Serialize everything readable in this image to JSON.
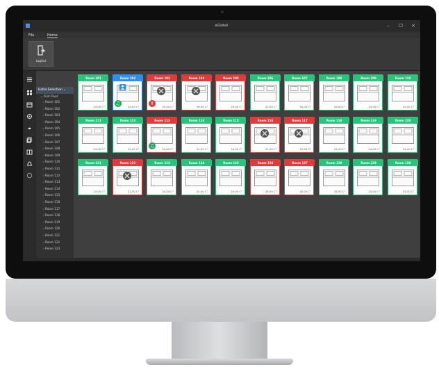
{
  "app": {
    "title": "eGlobal"
  },
  "window_controls": [
    "–",
    "☐",
    "×"
  ],
  "menu": {
    "file": "File",
    "home": "Home"
  },
  "ribbon": {
    "logout_label": "LogOut"
  },
  "tree": {
    "header": "Hotel Selection",
    "floor": "First Floor",
    "rooms": [
      "Room 101",
      "Room 102",
      "Room 103",
      "Room 104",
      "Room 105",
      "Room 106",
      "Room 107",
      "Room 108",
      "Room 109",
      "Room 110",
      "Room 111",
      "Room 112",
      "Room 113",
      "Room 114",
      "Room 115",
      "Room 116",
      "Room 117",
      "Room 118",
      "Room 119",
      "Room 120",
      "Room 121",
      "Room 122",
      "Room 123"
    ]
  },
  "colors": {
    "available": "#27c47a",
    "occupied": "#e03a3a",
    "selected": "#2d8ff0"
  },
  "rooms": [
    {
      "name": "Room 101",
      "status": "available",
      "temp": "24,00 C°"
    },
    {
      "name": "Room 102",
      "status": "selected",
      "temp": "22,00 C°",
      "badge": "green",
      "person": true
    },
    {
      "name": "Room 103",
      "status": "occupied",
      "temp": "20,00 C°",
      "badge": "red",
      "guest": true
    },
    {
      "name": "Room 104",
      "status": "occupied",
      "temp": "26,00 C°",
      "guest": true
    },
    {
      "name": "Room 105",
      "status": "occupied",
      "temp": "24,00 C°"
    },
    {
      "name": "Room 106",
      "status": "available",
      "temp": "22,00 C°"
    },
    {
      "name": "Room 107",
      "status": "available",
      "temp": "20,00 C°"
    },
    {
      "name": "Room 108",
      "status": "available",
      "temp": "26,00 C°"
    },
    {
      "name": "Room 109",
      "status": "available",
      "temp": "24,00 C°"
    },
    {
      "name": "Room 110",
      "status": "available",
      "temp": "24,00 C°"
    },
    {
      "name": "Room 111",
      "status": "available",
      "temp": "24,00 C°"
    },
    {
      "name": "Room 112",
      "status": "available",
      "temp": "24,00 C°"
    },
    {
      "name": "Room 113",
      "status": "occupied",
      "temp": "24,00 C°",
      "badge": "green"
    },
    {
      "name": "Room 114",
      "status": "available",
      "temp": "24,00 C°"
    },
    {
      "name": "Room 115",
      "status": "available",
      "temp": "24,00 C°"
    },
    {
      "name": "Room 116",
      "status": "occupied",
      "temp": "21,00 C°",
      "guest": true
    },
    {
      "name": "Room 117",
      "status": "occupied",
      "temp": "22,00 C°",
      "guest": true
    },
    {
      "name": "Room 118",
      "status": "available",
      "temp": "24,00 C°"
    },
    {
      "name": "Room 119",
      "status": "available",
      "temp": "24,00 C°"
    },
    {
      "name": "Room 120",
      "status": "available",
      "temp": "24,00 C°"
    },
    {
      "name": "Room 121",
      "status": "available",
      "temp": "24,00 C°"
    },
    {
      "name": "Room 122",
      "status": "occupied",
      "temp": "21,00 C°",
      "guest": true
    },
    {
      "name": "Room 123",
      "status": "available",
      "temp": "24,00 C°"
    },
    {
      "name": "Room 124",
      "status": "available",
      "temp": "24,00 C°"
    },
    {
      "name": "Room 125",
      "status": "available",
      "temp": "24,00 C°"
    },
    {
      "name": "Room 126",
      "status": "occupied",
      "temp": "26,00 C°"
    },
    {
      "name": "Room 127",
      "status": "occupied",
      "temp": "20,00 C°"
    },
    {
      "name": "Room 128",
      "status": "available",
      "temp": "24,00 C°"
    },
    {
      "name": "Room 129",
      "status": "available",
      "temp": "24,00 C°"
    },
    {
      "name": "Room 130",
      "status": "available",
      "temp": "24,00 C°"
    }
  ]
}
